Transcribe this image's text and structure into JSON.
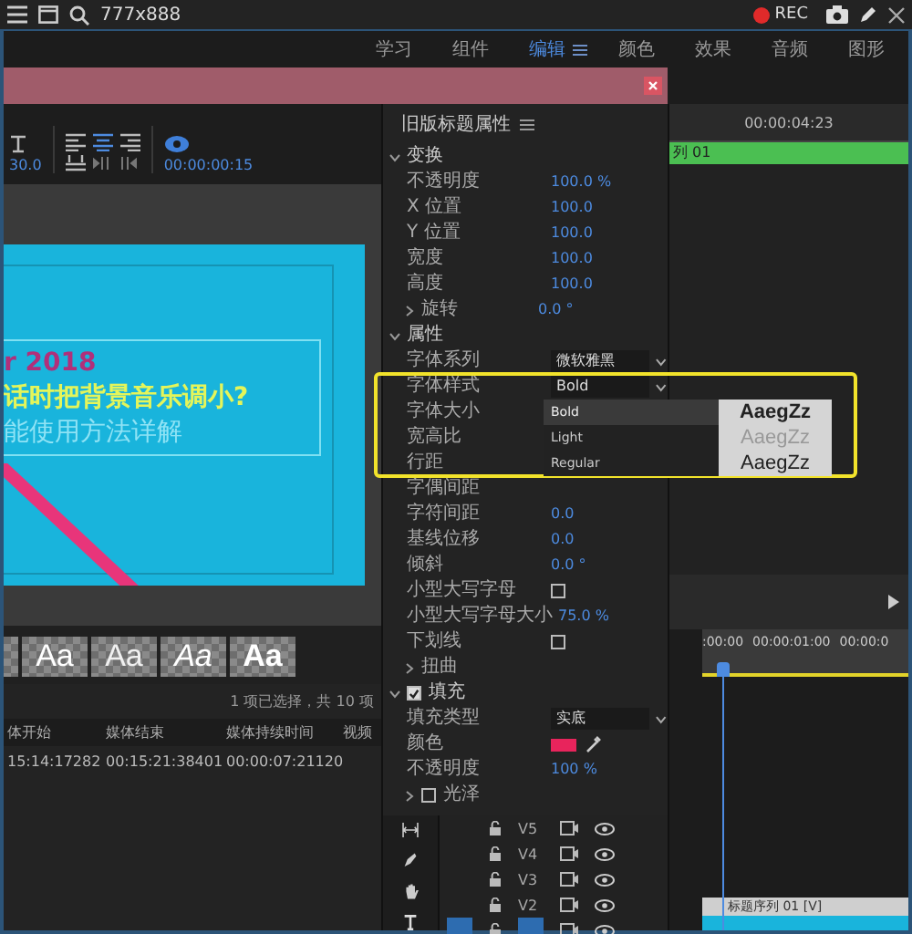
{
  "top_bar": {
    "title": "777x888",
    "rec": "REC"
  },
  "workspace_tabs": [
    {
      "label": "学习",
      "selected": false
    },
    {
      "label": "组件",
      "selected": false
    },
    {
      "label": "编辑",
      "selected": true
    },
    {
      "label": "颜色",
      "selected": false
    },
    {
      "label": "效果",
      "selected": false
    },
    {
      "label": "音频",
      "selected": false
    },
    {
      "label": "图形",
      "selected": false
    }
  ],
  "toolbar": {
    "frame_rate": "30.0",
    "timecode": "00:00:00:15"
  },
  "preview": {
    "lines": [
      {
        "text": "r 2018",
        "kind": "heading"
      },
      {
        "text": "话时把背景音乐调小?",
        "kind": "title"
      },
      {
        "text": "能使用方法详解",
        "kind": "caption"
      }
    ]
  },
  "styles": [
    {
      "label": "Aa",
      "kind": "regular"
    },
    {
      "label": "Aa",
      "kind": "light"
    },
    {
      "label": "Aa",
      "kind": "italic"
    },
    {
      "label": "Aa",
      "kind": "bold"
    }
  ],
  "project": {
    "status": "1 项已选择，共 10 项",
    "columns": [
      "体开始",
      "媒体结束",
      "媒体持续时间",
      "视频"
    ],
    "rows": [
      [
        "15:14:17282",
        "00:15:21:38401",
        "00:00:07:21120"
      ]
    ]
  },
  "properties": {
    "title": "旧版标题属性",
    "rows": [
      {
        "kind": "section",
        "label": "变换",
        "expanded": true
      },
      {
        "kind": "value",
        "label": "不透明度",
        "value": "100.0 %"
      },
      {
        "kind": "value",
        "label": "X 位置",
        "value": "100.0"
      },
      {
        "kind": "value",
        "label": "Y 位置",
        "value": "100.0"
      },
      {
        "kind": "value",
        "label": "宽度",
        "value": "100.0"
      },
      {
        "kind": "value",
        "label": "高度",
        "value": "100.0"
      },
      {
        "kind": "group",
        "label": "旋转",
        "expanded": false,
        "value": "0.0 °"
      },
      {
        "kind": "section",
        "label": "属性",
        "expanded": true
      },
      {
        "kind": "dropdown",
        "label": "字体系列",
        "value": "微软雅黑"
      },
      {
        "kind": "dropdown",
        "label": "字体样式",
        "value": "Bold"
      },
      {
        "kind": "label",
        "label": "字体大小"
      },
      {
        "kind": "label",
        "label": "宽高比"
      },
      {
        "kind": "label",
        "label": "行距"
      },
      {
        "kind": "label",
        "label": "字偶间距"
      },
      {
        "kind": "value",
        "label": "字符间距",
        "value": "0.0"
      },
      {
        "kind": "value",
        "label": "基线位移",
        "value": "0.0"
      },
      {
        "kind": "value",
        "label": "倾斜",
        "value": "0.0 °"
      },
      {
        "kind": "checkbox",
        "label": "小型大写字母",
        "checked": false
      },
      {
        "kind": "value",
        "label": "小型大写字母大小",
        "value": "75.0 %"
      },
      {
        "kind": "checkbox",
        "label": "下划线",
        "checked": false
      },
      {
        "kind": "group",
        "label": "扭曲",
        "expanded": false
      },
      {
        "kind": "section-check",
        "label": "填充",
        "expanded": true,
        "checked": true
      },
      {
        "kind": "dropdown",
        "label": "填充类型",
        "value": "实底"
      },
      {
        "kind": "color",
        "label": "颜色",
        "color": "#e8245c"
      },
      {
        "kind": "value",
        "label": "不透明度",
        "value": "100 %"
      },
      {
        "kind": "group-check",
        "label": "光泽",
        "expanded": false,
        "checked": false
      }
    ]
  },
  "font_style_menu": {
    "options": [
      {
        "label": "Bold",
        "sample": "AaegZz",
        "kind": "bold",
        "selected": true
      },
      {
        "label": "Light",
        "sample": "AaegZz",
        "kind": "light",
        "selected": false
      },
      {
        "label": "Regular",
        "sample": "AaegZz",
        "kind": "regular",
        "selected": false
      }
    ]
  },
  "timeline": {
    "timecode": "00:00:04:23",
    "clip": "列 01",
    "ruler": [
      ":00:00",
      "00:00:01:00",
      "00:00:0"
    ],
    "lower_clip": "标题序列 01 [V]",
    "tracks": [
      {
        "label": "V5",
        "targeted": false
      },
      {
        "label": "V4",
        "targeted": false
      },
      {
        "label": "V3",
        "targeted": false
      },
      {
        "label": "V2",
        "targeted": false
      },
      {
        "targeted": true
      }
    ]
  }
}
